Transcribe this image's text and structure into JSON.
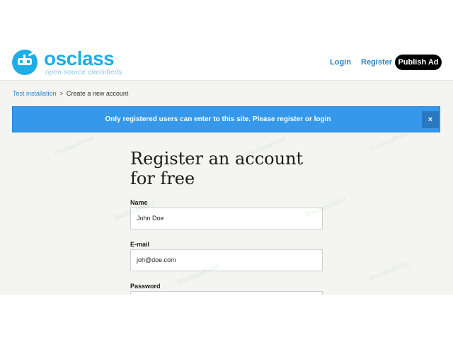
{
  "header": {
    "logo_text": "osclass",
    "logo_tagline": "open source classifieds",
    "nav": {
      "login": "Login",
      "register": "Register",
      "publish": "Publish Ad"
    }
  },
  "breadcrumb": {
    "home": "Test installation",
    "separator": ">",
    "current": "Create a new account"
  },
  "flash": {
    "message": "Only registered users can enter to this site. Please register or login",
    "close": "×"
  },
  "form": {
    "title": "Register an account for free",
    "name_label": "Name",
    "name_value": "John Doe",
    "email_label": "E-mail",
    "email_value": "joh@doe.com",
    "password_label": "Password"
  },
  "watermark": "OsclassPoint",
  "colors": {
    "brand": "#1eaee6",
    "link": "#2a84c6",
    "flash_bg": "#3598ea",
    "publish_bg": "#000000"
  }
}
